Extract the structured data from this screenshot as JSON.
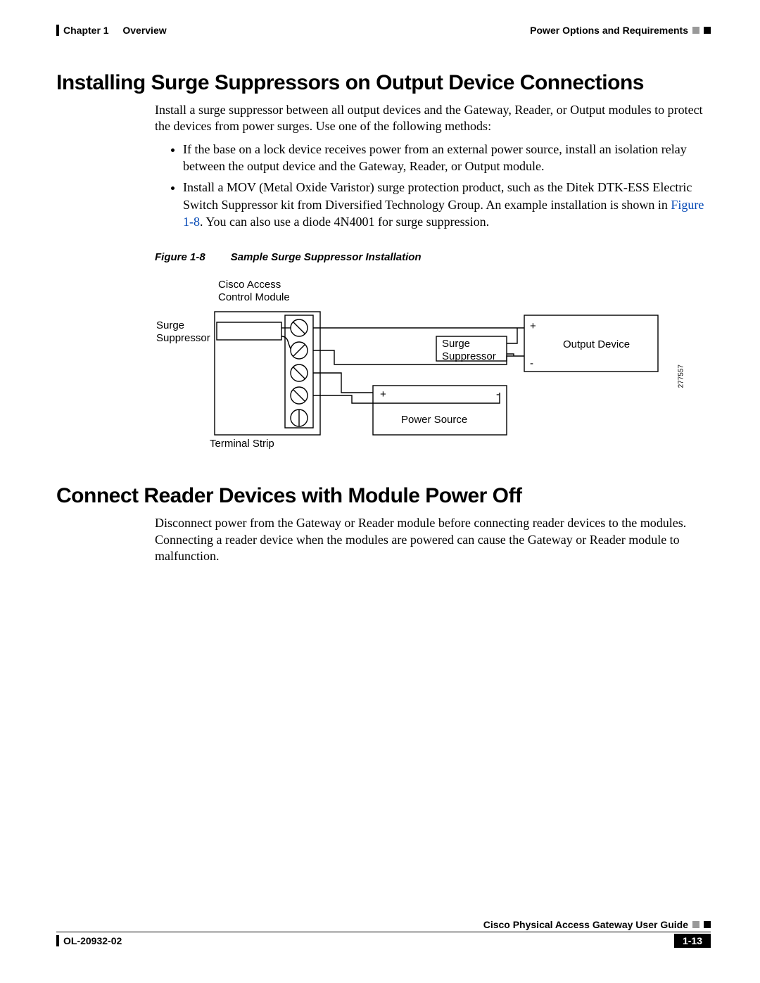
{
  "header": {
    "chapter_label": "Chapter 1",
    "chapter_title": "Overview",
    "section_path": "Power Options and Requirements"
  },
  "sections": {
    "s1": {
      "title": "Installing Surge Suppressors on Output Device Connections",
      "intro": "Install a surge suppressor between all output devices and the Gateway, Reader, or Output modules to protect the devices from power surges. Use one of the following methods:",
      "bullet1": "If the base on a lock device receives power from an external power source, install an isolation relay between the output device and the Gateway, Reader, or Output module.",
      "bullet2_a": "Install a MOV (Metal Oxide Varistor) surge protection product, such as the Ditek DTK-ESS Electric Switch Suppressor kit from Diversified Technology Group. An example installation is shown in ",
      "bullet2_link": "Figure 1-8",
      "bullet2_b": ". You can also use a diode 4N4001 for surge suppression."
    },
    "figure": {
      "label": "Figure 1-8",
      "title": "Sample Surge Suppressor Installation",
      "labels": {
        "module": "Cisco Access\nControl Module",
        "suppressor_left": "Surge\nSuppressor",
        "terminal": "Terminal Strip",
        "suppressor_mid": "Surge\nSuppressor",
        "power_source": "Power Source",
        "output_device": "Output Device",
        "plus": "+",
        "minus": "-",
        "diag_id": "277557"
      }
    },
    "s2": {
      "title": "Connect Reader Devices with Module Power Off",
      "body": "Disconnect power from the Gateway or Reader module before connecting reader devices to the modules. Connecting a reader device when the modules are powered can cause the Gateway or Reader module to malfunction."
    }
  },
  "footer": {
    "book_title": "Cisco Physical Access Gateway User Guide",
    "doc_id": "OL-20932-02",
    "page_no": "1-13"
  }
}
